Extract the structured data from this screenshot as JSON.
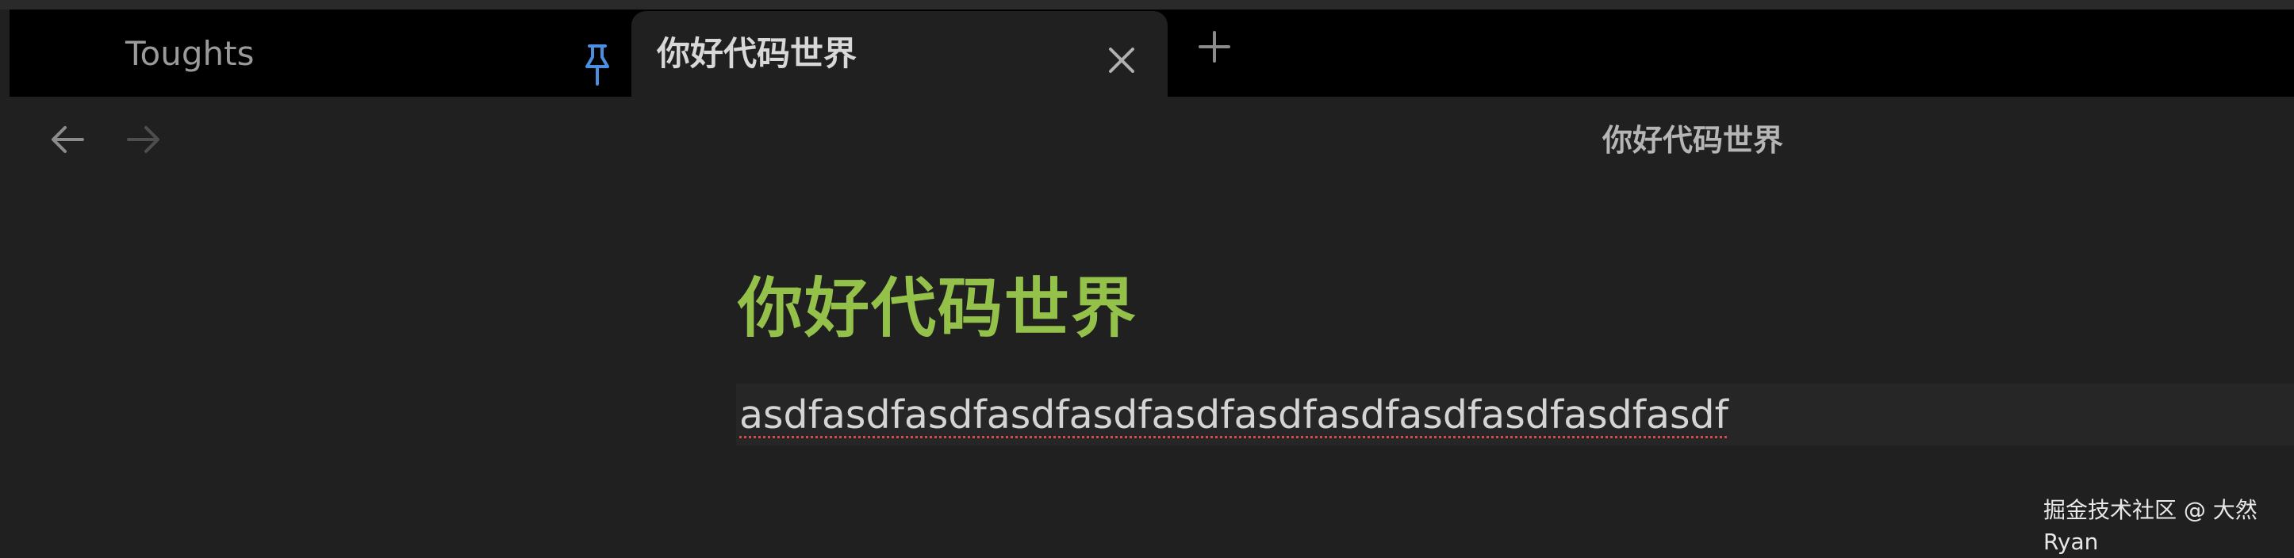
{
  "tabs": [
    {
      "label": "Toughts",
      "state": "inactive",
      "icon": "pin-icon"
    },
    {
      "label": "你好代码世界",
      "state": "active",
      "icon": "close-icon"
    }
  ],
  "nav": {
    "back_icon": "arrow-left-icon",
    "forward_icon": "arrow-right-icon"
  },
  "view_title": "你好代码世界",
  "document": {
    "heading": "你好代码世界",
    "body": "asdfasdfasdfasdfasdfasdfasdfasdfasdfasdfasdfasdf"
  },
  "watermark": "掘金技术社区 @ 大然Ryan",
  "colors": {
    "accent_heading": "#93c14a",
    "pin": "#4a8fe0",
    "spell_underline": "#d24b4b"
  }
}
